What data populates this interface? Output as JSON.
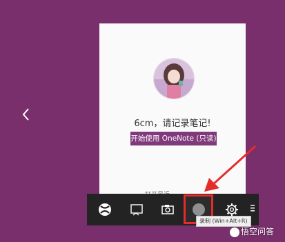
{
  "colors": {
    "background": "#7a2f6d",
    "card": "#fbfafb",
    "accent": "#80397b",
    "gamebar": "#232323",
    "highlight": "#e52b2b",
    "arrow": "#e52b2b"
  },
  "card": {
    "greeting": "6cm，请记录笔记!",
    "start_label": "开始使用 OneNote (只读)",
    "bottom_text": "打开最近"
  },
  "gamebar": {
    "icons": [
      "xbox-icon",
      "screen-capture-icon",
      "camera-icon",
      "record-icon",
      "settings-icon",
      "menu-icon"
    ],
    "tooltip": "录制 (Win+Alt+R)"
  },
  "watermark": {
    "text": "悟空问答"
  }
}
